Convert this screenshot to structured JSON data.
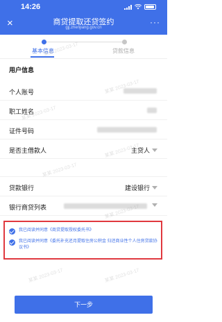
{
  "status": {
    "time": "14:26"
  },
  "nav": {
    "title": "商贷提取还贷签约",
    "subtitle": "gjj.zhenjiang.gov.cn",
    "close": "×",
    "more": "···"
  },
  "steps": [
    {
      "label": "基本信息",
      "state": "active"
    },
    {
      "label": "贷款信息",
      "state": "inactive"
    }
  ],
  "section_title": "用户信息",
  "fields": [
    {
      "label": "个人账号",
      "value": ""
    },
    {
      "label": "职工姓名",
      "value": ""
    },
    {
      "label": "证件号码",
      "value": ""
    },
    {
      "label": "是否主借款人",
      "value": "主贷人"
    },
    {
      "label": "贷款银行",
      "value": "建设银行"
    },
    {
      "label": "银行商贷列表",
      "value": ""
    }
  ],
  "agreements": [
    {
      "text": "我已阅读并同意《商贷提取授权委托书》"
    },
    {
      "text": "我已阅读并同意《委托补充还月提取住房公积金 归还商业性个人住房贷款协议书》"
    }
  ],
  "next_button": "下一步",
  "watermark": "某某 2023-03-17",
  "colors": {
    "primary": "#3f70e8",
    "highlight_border": "#e0383e"
  }
}
